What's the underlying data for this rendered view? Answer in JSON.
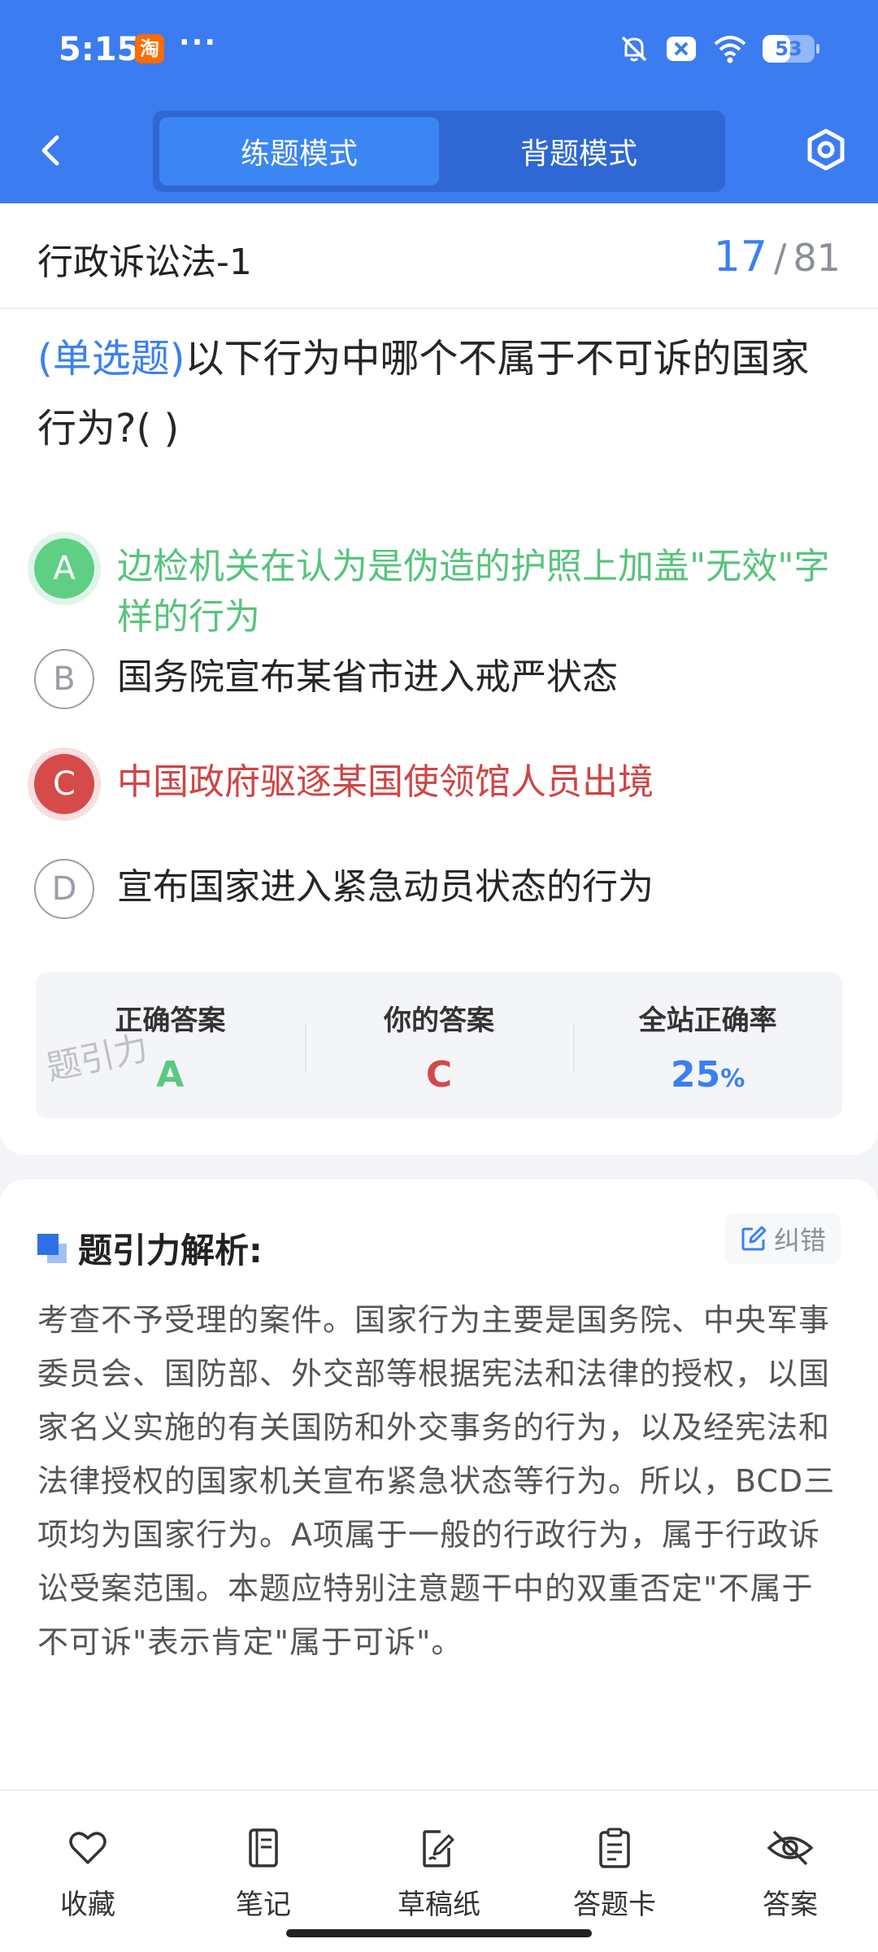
{
  "status_bar": {
    "time": "5:15",
    "app_badge": "淘",
    "more": "···",
    "battery_level": "53"
  },
  "header": {
    "tabs": [
      {
        "label": "练题模式",
        "active": true
      },
      {
        "label": "背题模式",
        "active": false
      }
    ]
  },
  "title_row": {
    "title": "行政诉讼法-1",
    "current": "17",
    "separator": "/",
    "total": "81"
  },
  "question": {
    "type": "(单选题)",
    "text": "以下行为中哪个不属于不可诉的国家行为?(        )"
  },
  "options": [
    {
      "letter": "A",
      "text": "边检机关在认为是伪造的护照上加盖\"无效\"字样的行为",
      "state": "correct"
    },
    {
      "letter": "B",
      "text": "国务院宣布某省市进入戒严状态",
      "state": "normal"
    },
    {
      "letter": "C",
      "text": "中国政府驱逐某国使领馆人员出境",
      "state": "wrong"
    },
    {
      "letter": "D",
      "text": "宣布国家进入紧急动员状态的行为",
      "state": "normal"
    }
  ],
  "answer_summary": {
    "correct_label": "正确答案",
    "correct_value": "A",
    "yours_label": "你的答案",
    "yours_value": "C",
    "rate_label": "全站正确率",
    "rate_value": "25",
    "rate_unit": "%",
    "watermark": "题引力"
  },
  "analysis": {
    "title": "题引力解析:",
    "fix_label": "纠错",
    "text": "考查不予受理的案件。国家行为主要是国务院、中央军事委员会、国防部、外交部等根据宪法和法律的授权，以国家名义实施的有关国防和外交事务的行为，以及经宪法和法律授权的国家机关宣布紧急状态等行为。所以，BCD三项均为国家行为。A项属于一般的行政行为，属于行政诉讼受案范围。本题应特别注意题干中的双重否定\"不属于不可诉\"表示肯定\"属于可诉\"。"
  },
  "bottom_nav": [
    {
      "label": "收藏",
      "icon": "heart-icon"
    },
    {
      "label": "笔记",
      "icon": "notebook-icon"
    },
    {
      "label": "草稿纸",
      "icon": "draft-icon"
    },
    {
      "label": "答题卡",
      "icon": "answer-sheet-icon"
    },
    {
      "label": "答案",
      "icon": "eye-off-icon"
    }
  ],
  "colors": {
    "header_blue": "#3b7cf0",
    "correct_green": "#5fcf86",
    "wrong_red": "#d64a4a",
    "accent_blue": "#3a80f1"
  }
}
